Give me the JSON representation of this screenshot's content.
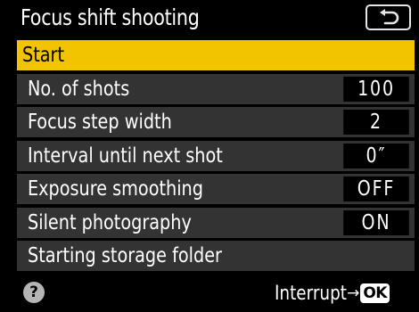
{
  "header": {
    "title": "Focus shift shooting",
    "back_icon": "back-arrow-icon"
  },
  "menu": {
    "items": [
      {
        "label": "Start",
        "value": "",
        "selected": true
      },
      {
        "label": "No. of shots",
        "value": "100"
      },
      {
        "label": "Focus step width",
        "value": "2"
      },
      {
        "label": "Interval until next shot",
        "value": "0″"
      },
      {
        "label": "Exposure smoothing",
        "value": "OFF"
      },
      {
        "label": "Silent photography",
        "value": "ON"
      },
      {
        "label": "Starting storage folder",
        "value": ""
      }
    ]
  },
  "footer": {
    "help_icon_text": "?",
    "interrupt_label": "Interrupt",
    "arrow": "→",
    "ok_label": "OK"
  },
  "colors": {
    "background": "#000000",
    "row": "#333333",
    "highlight": "#f2c400",
    "value_box": "#000000",
    "text": "#ffffff"
  }
}
